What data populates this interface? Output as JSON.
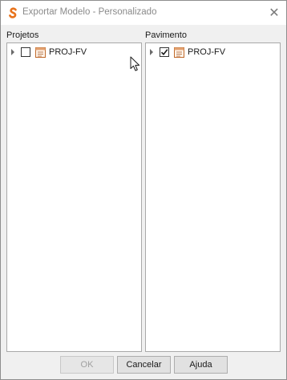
{
  "window": {
    "title": "Exportar Modelo - Personalizado",
    "close_symbol": "✕",
    "brand_color": "#e8731c"
  },
  "left_panel": {
    "label": "Projetos",
    "items": [
      {
        "label": "PROJ-FV",
        "checked": false
      }
    ]
  },
  "right_panel": {
    "label": "Pavimento",
    "items": [
      {
        "label": "PROJ-FV",
        "checked": true
      }
    ]
  },
  "buttons": {
    "ok": "OK",
    "cancel": "Cancelar",
    "help": "Ajuda"
  }
}
